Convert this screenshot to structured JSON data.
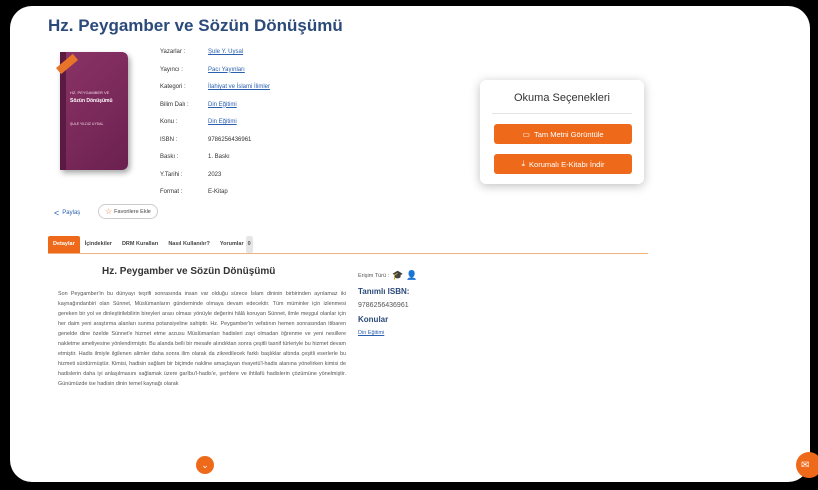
{
  "book": {
    "title": "Hz. Peygamber ve Sözün Dönüşümü",
    "cover": {
      "line1": "HZ. PEYGAMBER VE",
      "line2": "Sözün Dönüşümü",
      "line3": "ŞULE YILDIZ UYSAL"
    },
    "meta": [
      {
        "key": "Yazarlar :",
        "value": "Şule Y. Uysal",
        "link": true
      },
      {
        "key": "Yayıncı :",
        "value": "Pacı Yayınları",
        "link": true
      },
      {
        "key": "Kategori :",
        "value": "İlahiyat ve İslami İlimler",
        "link": true
      },
      {
        "key": "Bilim Dalı :",
        "value": "Din Eğitimi",
        "link": true
      },
      {
        "key": "Konu :",
        "value": "Din Eğitimi",
        "link": true
      },
      {
        "key": "ISBN :",
        "value": "9786256436961",
        "link": false
      },
      {
        "key": "Baskı :",
        "value": "1. Baskı",
        "link": false
      },
      {
        "key": "Y.Tarihi :",
        "value": "2023",
        "link": false
      },
      {
        "key": "Format :",
        "value": "E-Kitap",
        "link": false
      }
    ]
  },
  "actions": {
    "share_label": "Paylaş",
    "favorite_label": "Favorilere Ekle"
  },
  "reading": {
    "heading": "Okuma Seçenekleri",
    "full_text_label": "Tam Metni Görüntüle",
    "download_label": "Korumalı E-Kitabı İndir"
  },
  "tabs": [
    {
      "label": "Detaylar",
      "active": true
    },
    {
      "label": "İçindekiler",
      "active": false
    },
    {
      "label": "DRM Kuralları",
      "active": false
    },
    {
      "label": "Nasıl Kullanılır?",
      "active": false
    },
    {
      "label": "Yorumlar",
      "active": false,
      "count": "0"
    }
  ],
  "content": {
    "title": "Hz. Peygamber ve Sözün Dönüşümü",
    "body": "Son Peygamber'in bu dünyayı teşrifi sonrasında insan var olduğu sürece İslam dininin birbirinden ayrılamaz iki kaynağındanbiri olan Sünnet, Müslümanların gündeminde olmaya devam edecektir. Tüm müminler için izlenmesi gereken bir yol ve dinleştirilebilirin bireyleri arası olması yönüyle değerini hâlâ koruyan Sünnet, ilmle meşgul olanlar için her daim yeni araştırma alanları sunma potansiyeline sahiptir. Hz. Peygamber'in vefatının hemen sonrasından itibaren genelde dine özelde Sünnet'e hizmet etme arzusu Müslümanları hadisleri zayi olmadan öğrenme ve yeni nesillere nakletme ameliyesine yönlendirmiştir. Bu alanda belli bir mesafe alındıktan sonra çeşitli tasnif türleriyle bu hizmet devam etmiştir. Hadis ilmiyle ilgilenen alimler daha sonra ilim olarak da zikredilecek farklı başlıklar altında çeşitli eserlerle bu hizmeti sürdürmüştür. Kimisi, hadisin sağlam bir biçimde nakline amaçlayan rivayetü'l-hadis alanına yönelirken kimisi de hadislerin daha iyi anlaşılmasını sağlamak üzere garîbu'l-hadis'e, şerhlere ve ihtilafü hadislerin çözümüne yönelmiştir. Günümüzde ise hadisin dinin temel kaynağı olarak"
  },
  "side": {
    "access_label": "Erişim Türü :",
    "isbn_label": "Tanımlı ISBN:",
    "isbn_value": "9786256436961",
    "topics_label": "Konular",
    "topic_link": "Din Eğitimi"
  }
}
